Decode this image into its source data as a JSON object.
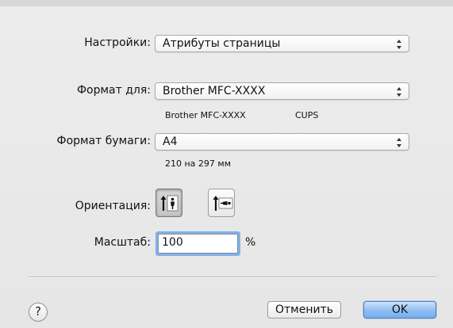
{
  "dialog": {
    "settings_label": "Настройки:",
    "settings_value": "Атрибуты страницы",
    "format_for_label": "Формат для:",
    "format_for_value": "Brother MFC-XXXX",
    "printer_description": "Brother MFC-XXXX",
    "printer_driver": "CUPS",
    "paper_size_label": "Формат бумаги:",
    "paper_size_value": "A4",
    "paper_dimensions": "210 на 297 мм",
    "orientation_label": "Ориентация:",
    "orientation_selected": "portrait",
    "scale_label": "Масштаб:",
    "scale_value": "100",
    "scale_unit": "%",
    "help_symbol": "?",
    "cancel_label": "Отменить",
    "ok_label": "OK"
  },
  "colors": {
    "focus_ring": "#7fb1ee",
    "default_button": "#76aef0"
  },
  "icons": [
    "popup-arrows-icon",
    "portrait-orientation-icon",
    "landscape-orientation-icon",
    "help-icon"
  ]
}
